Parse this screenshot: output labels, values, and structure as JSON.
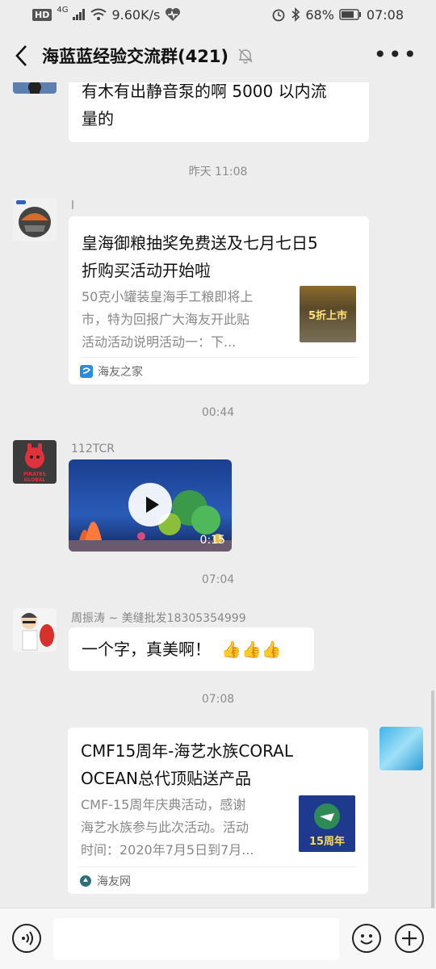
{
  "status": {
    "hd": "HD",
    "net": "4G",
    "speed": "9.60K/s",
    "battery": "68%",
    "time": "07:08"
  },
  "header": {
    "title": "海蓝蓝经验交流群(421)"
  },
  "messages": {
    "m1_text_line1": "有木有出静音泵的啊 5000 以内流",
    "m1_text_line2": "量的",
    "time1": "昨天 11:08",
    "m2_sender": "l",
    "m2_title_line1": "皇海御粮抽奖免费送及七月七日5",
    "m2_title_line2": "折购买活动开始啦",
    "m2_desc_line1": "50克小罐装皇海手工粮即将上",
    "m2_desc_line2": "市，特为回报广大海友开此贴",
    "m2_desc_line3": "活动活动说明活动一：下...",
    "m2_source": "海友之家",
    "time2": "00:44",
    "m3_sender": "112TCR",
    "m3_duration": "0:15",
    "time3": "07:04",
    "m4_sender": "周振涛 ~ 美缝批发18305354999",
    "m4_text": "一个字，真美啊！",
    "m4_emoji": "👍👍👍",
    "time4": "07:08",
    "m5_title_line1": "CMF15周年-海艺水族CORAL",
    "m5_title_line2": "OCEAN总代顶贴送产品",
    "m5_desc_line1": "CMF-15周年庆典活动，感谢",
    "m5_desc_line2": "海艺水族参与此次活动。活动",
    "m5_desc_line3": "时间：2020年7月5日到7月...",
    "m5_source": "海友网"
  },
  "thumbs": {
    "m2_thumb_text1": "5折上市",
    "m5_thumb_text1": "15周年",
    "avatar3_text": "PIRATES GLOBAL"
  }
}
